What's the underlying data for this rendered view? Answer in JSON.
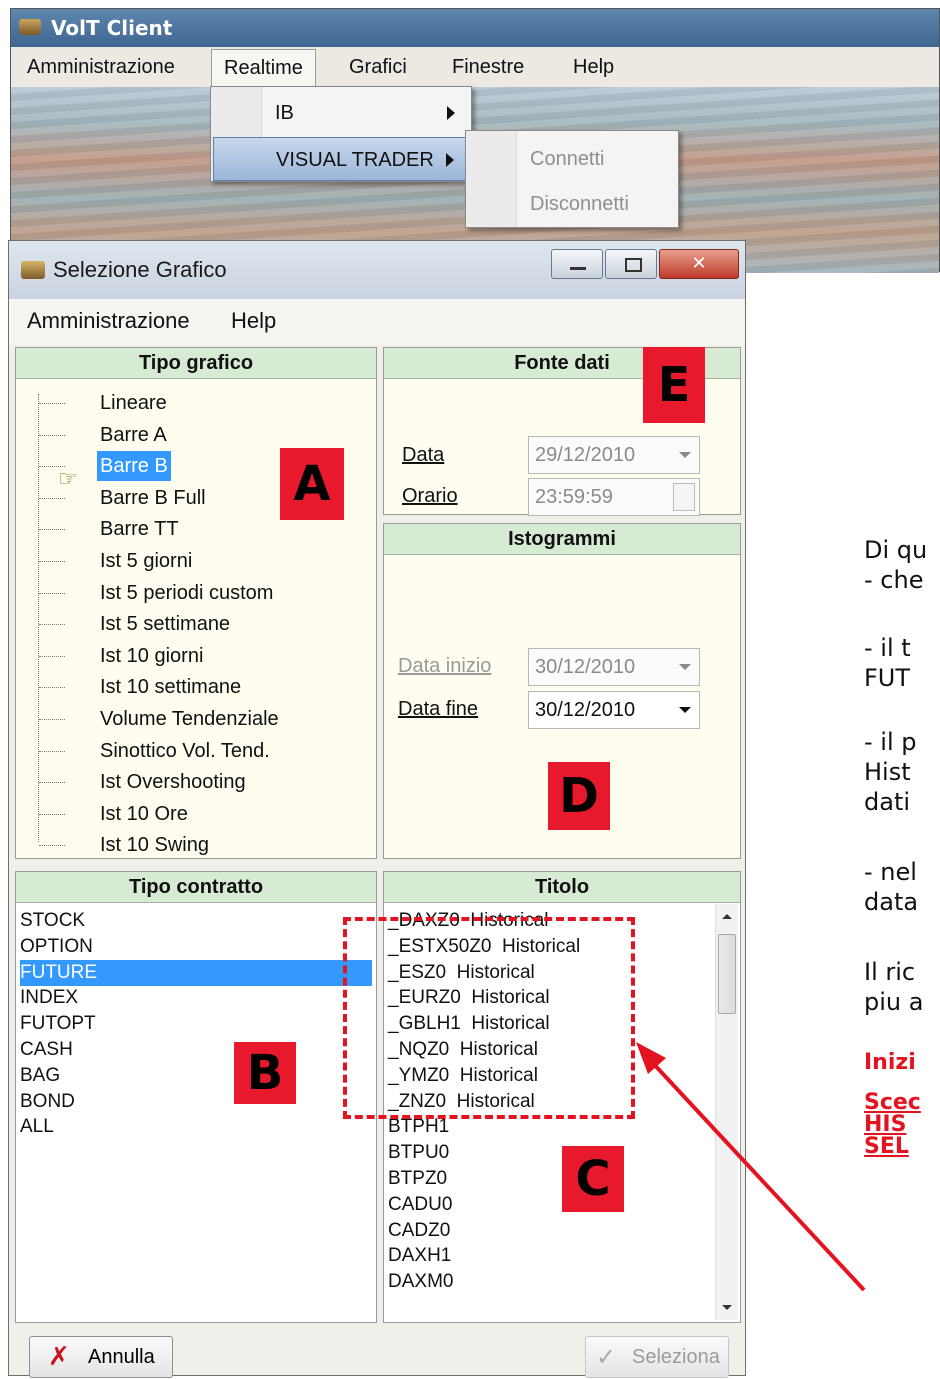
{
  "client": {
    "title": "VolT Client",
    "menu": [
      "Amministrazione",
      "Realtime",
      "Grafici",
      "Finestre",
      "Help"
    ],
    "realtime_menu": [
      "IB",
      "VISUAL TRADER"
    ],
    "visual_trader_submenu": [
      "Connetti",
      "Disconnetti"
    ]
  },
  "dialog": {
    "title": "Selezione Grafico",
    "menu": [
      "Amministrazione",
      "Help"
    ],
    "tipo_grafico": {
      "header": "Tipo grafico",
      "items": [
        "Lineare",
        "Barre A",
        "Barre B",
        "Barre B Full",
        "Barre TT",
        "Ist 5 giorni",
        "Ist 5 periodi custom",
        "Ist 5 settimane",
        "Ist 10 giorni",
        "Ist 10 settimane",
        "Volume Tendenziale",
        "Sinottico Vol. Tend.",
        "Ist Overshooting",
        "Ist 10 Ore",
        "Ist 10 Swing"
      ],
      "selected": "Barre B"
    },
    "fonte_dati": {
      "header": "Fonte dati",
      "data_label": "Data",
      "data_value": "29/12/2010",
      "orario_label": "Orario",
      "orario_value": "23:59:59"
    },
    "istogrammi": {
      "header": "Istogrammi",
      "data_inizio_label": "Data inizio",
      "data_inizio_value": "30/12/2010",
      "data_fine_label": "Data fine",
      "data_fine_value": "30/12/2010"
    },
    "tipo_contratto": {
      "header": "Tipo contratto",
      "items": [
        "STOCK",
        "OPTION",
        "FUTURE",
        "INDEX",
        "FUTOPT",
        "CASH",
        "BAG",
        "BOND",
        "ALL"
      ],
      "selected": "FUTURE"
    },
    "titolo": {
      "header": "Titolo",
      "items": [
        "_DAXZ0  Historical",
        "_ESTX50Z0  Historical",
        "_ESZ0  Historical",
        "_EURZ0  Historical",
        "_GBLH1  Historical",
        "_NQZ0  Historical",
        "_YMZ0  Historical",
        "_ZNZ0  Historical",
        "BTPH1",
        "BTPU0",
        "BTPZ0",
        "CADU0",
        "CADZ0",
        "DAXH1",
        "DAXM0"
      ]
    },
    "buttons": {
      "annulla": "Annulla",
      "seleziona": "Seleziona"
    }
  },
  "tags": {
    "a": "A",
    "b": "B",
    "c": "C",
    "d": "D",
    "e": "E"
  },
  "right_text": {
    "lines": [
      "Di qu",
      "- che",
      "- il t",
      "FUT",
      "- il p",
      "Hist",
      "dati",
      "- nel",
      "data",
      "Il ric",
      "piu a"
    ],
    "red_lines": [
      "Inizi",
      "Scec",
      "HIS",
      "SEL"
    ]
  },
  "colors": {
    "tag_red": "#e8192c",
    "selection_blue": "#3399ff",
    "header_green": "#d7ead4"
  }
}
